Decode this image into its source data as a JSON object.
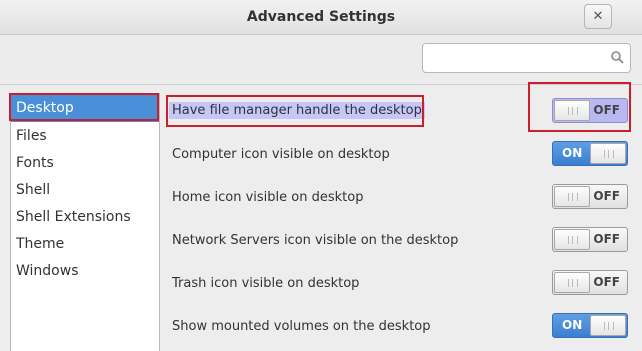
{
  "window": {
    "title": "Advanced Settings"
  },
  "search": {
    "placeholder": ""
  },
  "sidebar": {
    "items": [
      {
        "label": "Desktop",
        "selected": true
      },
      {
        "label": "Files"
      },
      {
        "label": "Fonts"
      },
      {
        "label": "Shell"
      },
      {
        "label": "Shell Extensions"
      },
      {
        "label": "Theme"
      },
      {
        "label": "Windows"
      }
    ]
  },
  "settings": [
    {
      "label": "Have file manager handle the desktop",
      "state": "OFF"
    },
    {
      "label": "Computer icon visible on desktop",
      "state": "ON"
    },
    {
      "label": "Home icon visible on desktop",
      "state": "OFF"
    },
    {
      "label": "Network Servers icon visible on the desktop",
      "state": "OFF"
    },
    {
      "label": "Trash icon visible on desktop",
      "state": "OFF"
    },
    {
      "label": "Show mounted volumes on the desktop",
      "state": "ON"
    }
  ],
  "colors": {
    "accent": "#4a90d9",
    "highlight_border": "#cc1f2d",
    "highlight_fill": "#c6c6f8"
  }
}
